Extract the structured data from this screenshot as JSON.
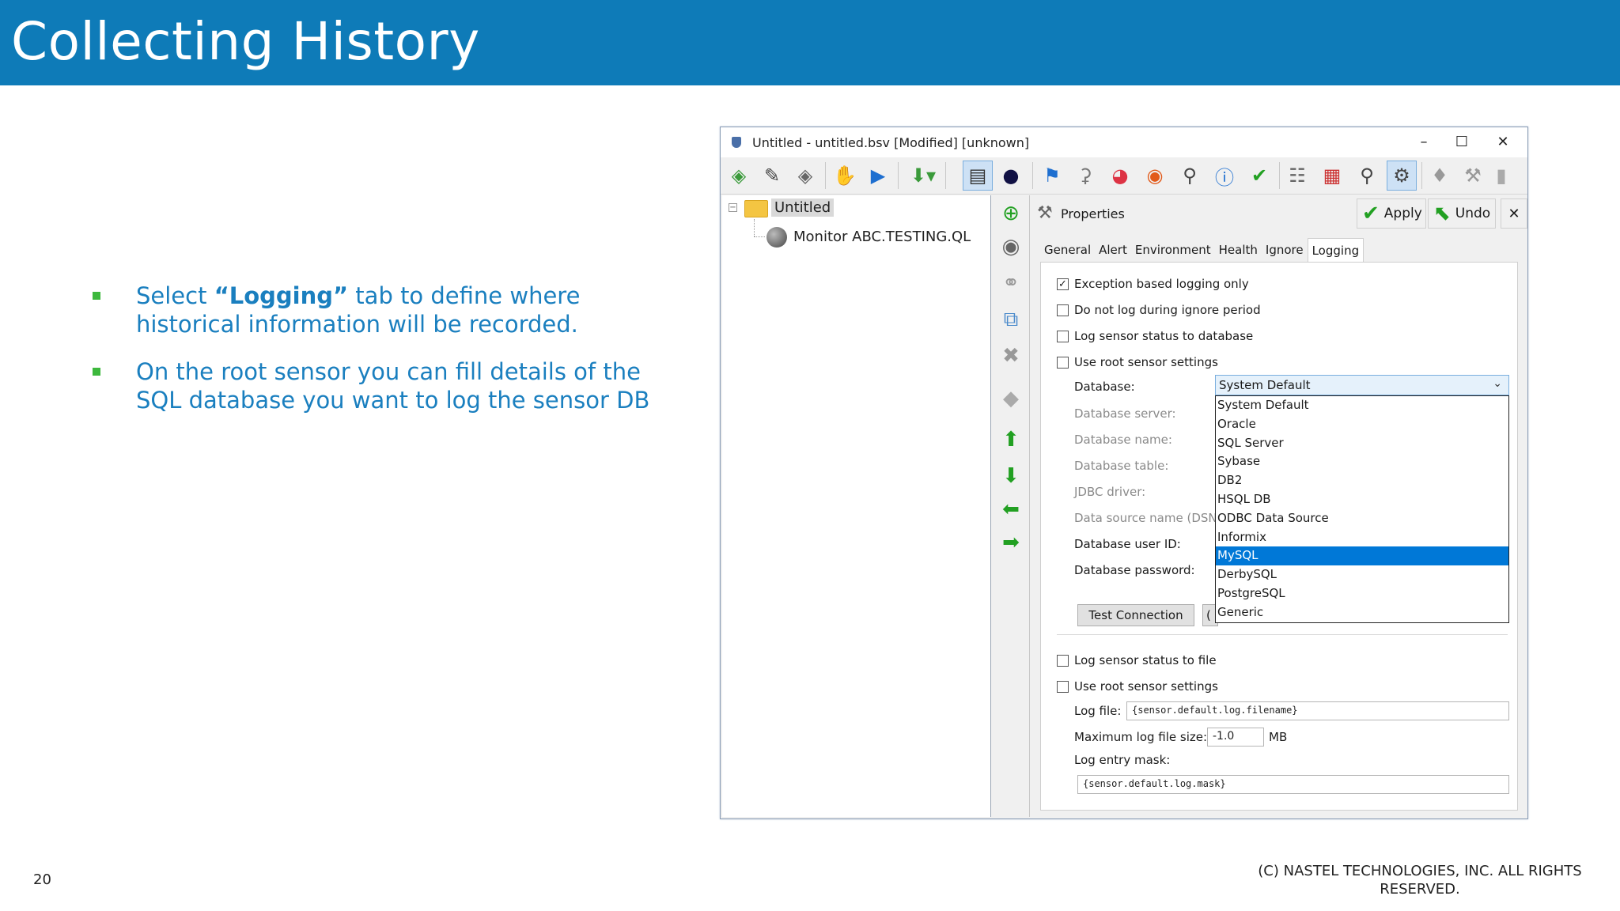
{
  "slide": {
    "title": "Collecting History",
    "bullets": [
      {
        "pre": "Select ",
        "bold": "“Logging”",
        "post": " tab to define where historical information will be recorded."
      },
      {
        "text": "On the root sensor you can fill details of the  SQL database you want to log the sensor DB"
      }
    ],
    "page_number": "20",
    "copyright": "(C) NASTEL TECHNOLOGIES, INC. ALL RIGHTS RESERVED.",
    "colors": {
      "banner": "#0e7bb8",
      "bullet_text": "#1a7fbf",
      "bullet_marker": "#3db83d"
    }
  },
  "window": {
    "title": "Untitled - untitled.bsv [Modified] [unknown]",
    "controls": {
      "minimize": "–",
      "maximize": "☐",
      "close": "✕"
    },
    "toolbar_icons": [
      "open-icon",
      "edit-icon",
      "eraser-icon",
      "stop-icon",
      "play-icon",
      "download-icon",
      "tree-view-icon",
      "globe-icon",
      "flag-icon",
      "microscope-icon",
      "pie-chart-icon",
      "alarm-icon",
      "search-icon",
      "info-icon",
      "check-icon",
      "book-icon",
      "calendar-icon",
      "inspect-icon",
      "settings-icon",
      "tag-icon",
      "tool-icon",
      "lock-icon"
    ],
    "tree": {
      "root_label": "Untitled",
      "child_label": "Monitor ABC.TESTING.QL"
    },
    "side_toolbar_icons": [
      "add-icon",
      "add-sensor-icon",
      "link-icon",
      "copy-icon",
      "delete-icon",
      "diamond-icon",
      "up-arrow-icon",
      "down-arrow-icon",
      "left-arrow-icon",
      "right-arrow-icon"
    ],
    "properties": {
      "title": "Properties",
      "apply": "Apply",
      "undo": "Undo",
      "close": "✕",
      "tabs": [
        "General",
        "Alert",
        "Environment",
        "Health",
        "Ignore",
        "Logging"
      ],
      "active_tab": "Logging",
      "checkboxes": [
        {
          "label": "Exception based logging only",
          "checked": true
        },
        {
          "label": "Do not log during ignore period",
          "checked": false
        },
        {
          "label": "Log sensor status to database",
          "checked": false
        },
        {
          "label": "Use root sensor settings",
          "checked": false
        }
      ],
      "db_fields": [
        {
          "label": "Database:",
          "enabled": true
        },
        {
          "label": "Database server:",
          "enabled": false
        },
        {
          "label": "Database name:",
          "enabled": false
        },
        {
          "label": "Database table:",
          "enabled": false
        },
        {
          "label": "JDBC driver:",
          "enabled": false
        },
        {
          "label": "Data source name (DSN):",
          "enabled": false
        },
        {
          "label": "Database user ID:",
          "enabled": true
        },
        {
          "label": "Database password:",
          "enabled": true
        }
      ],
      "database_selected": "System Default",
      "database_options": [
        "System Default",
        "Oracle",
        "SQL Server",
        "Sybase",
        "DB2",
        "HSQL DB",
        "ODBC Data Source",
        "Informix",
        "MySQL",
        "DerbySQL",
        "PostgreSQL",
        "Generic"
      ],
      "database_highlighted": "MySQL",
      "test_connection": "Test Connection",
      "second_button_partial": "(",
      "file_checkboxes": [
        {
          "label": "Log sensor status to file",
          "checked": false
        },
        {
          "label": "Use root sensor settings",
          "checked": false
        }
      ],
      "log_file_label": "Log file:",
      "log_file_value": "{sensor.default.log.filename}",
      "max_size_label": "Maximum log file size:",
      "max_size_value": "-1.0",
      "max_size_unit": "MB",
      "entry_mask_label": "Log entry mask:",
      "entry_mask_value": "{sensor.default.log.mask}"
    }
  }
}
